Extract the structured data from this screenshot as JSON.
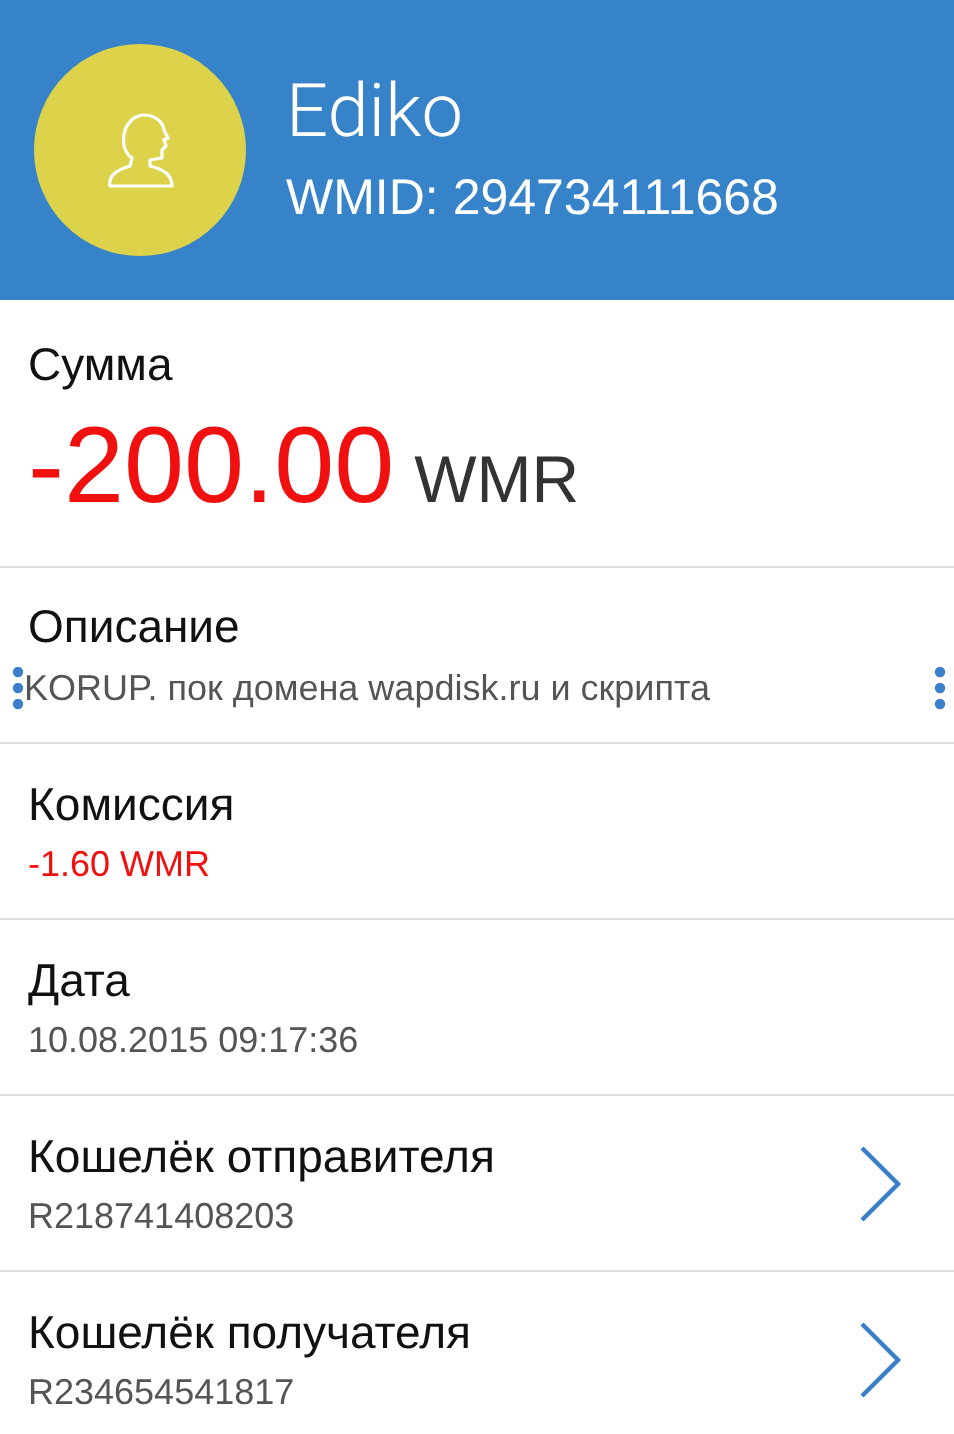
{
  "header": {
    "name": "Ediko",
    "wmid": "WMID: 294734111668"
  },
  "amount": {
    "label": "Сумма",
    "value": "-200.00",
    "currency": "WMR"
  },
  "rows": [
    {
      "kind": "selectable",
      "label": "Описание",
      "value": "KORUP. пок домена wapdisk.ru и скрипта"
    },
    {
      "kind": "negative",
      "label": "Комиссия",
      "value": "-1.60 WMR"
    },
    {
      "kind": "plain",
      "label": "Дата",
      "value": "10.08.2015 09:17:36"
    },
    {
      "kind": "link",
      "label": "Кошелёк отправителя",
      "value": "R218741408203"
    },
    {
      "kind": "link",
      "label": "Кошелёк получателя",
      "value": "R234654541817"
    }
  ]
}
